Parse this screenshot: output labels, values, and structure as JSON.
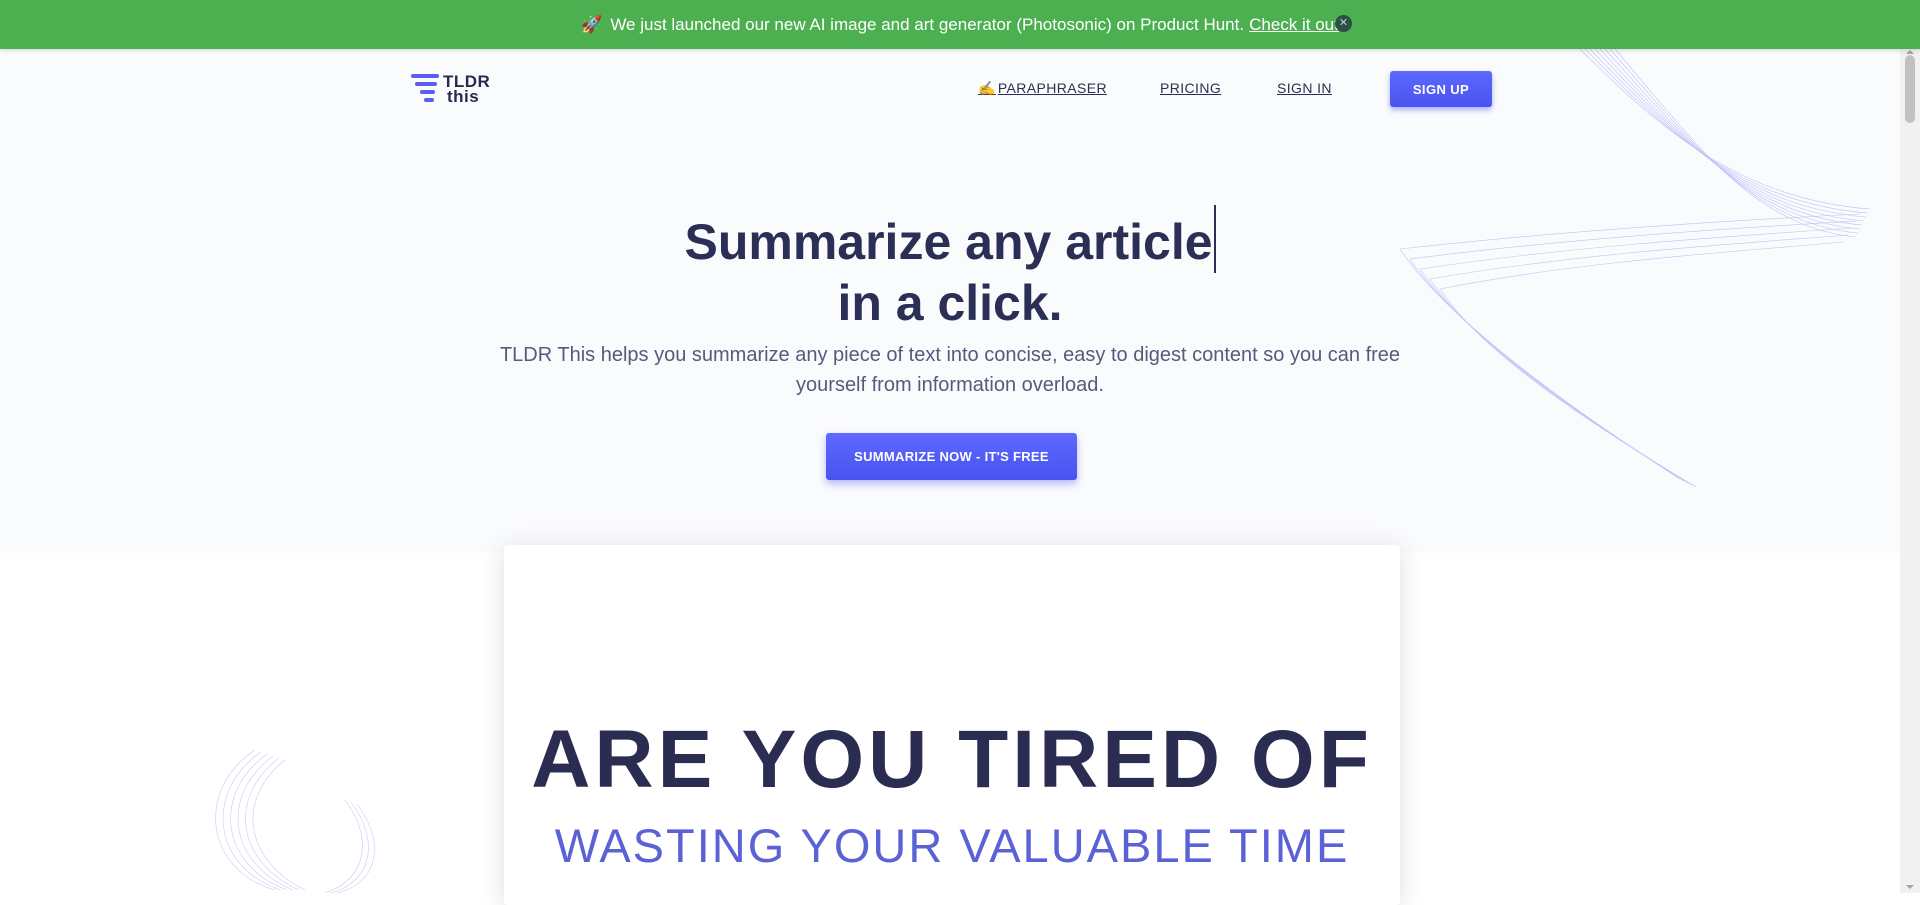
{
  "banner": {
    "icon": "rocket-icon",
    "text": "We just launched our new AI image and art generator (Photosonic) on Product Hunt.",
    "link_label": "Check it out",
    "close_icon": "close-icon",
    "bg_color": "#4caf50"
  },
  "logo": {
    "line1": "TLDR",
    "line2": "this"
  },
  "nav": {
    "paraphraser": "PARAPHRASER",
    "paraphraser_icon": "pencil-icon",
    "pricing": "PRICING",
    "signin": "SIGN IN",
    "signup": "SIGN UP"
  },
  "hero": {
    "title_line1": "Summarize any article",
    "title_line2": "in a click.",
    "subtitle": "TLDR This helps you summarize any piece of text into concise, easy to digest content so you can free yourself from information overload.",
    "cta": "SUMMARIZE NOW - IT'S FREE"
  },
  "card": {
    "line1": "ARE YOU TIRED OF",
    "line2": "WASTING YOUR VALUABLE TIME"
  },
  "colors": {
    "accent": "#4a54f0",
    "heading": "#2b2f55",
    "card_subline": "#5a62d6"
  }
}
